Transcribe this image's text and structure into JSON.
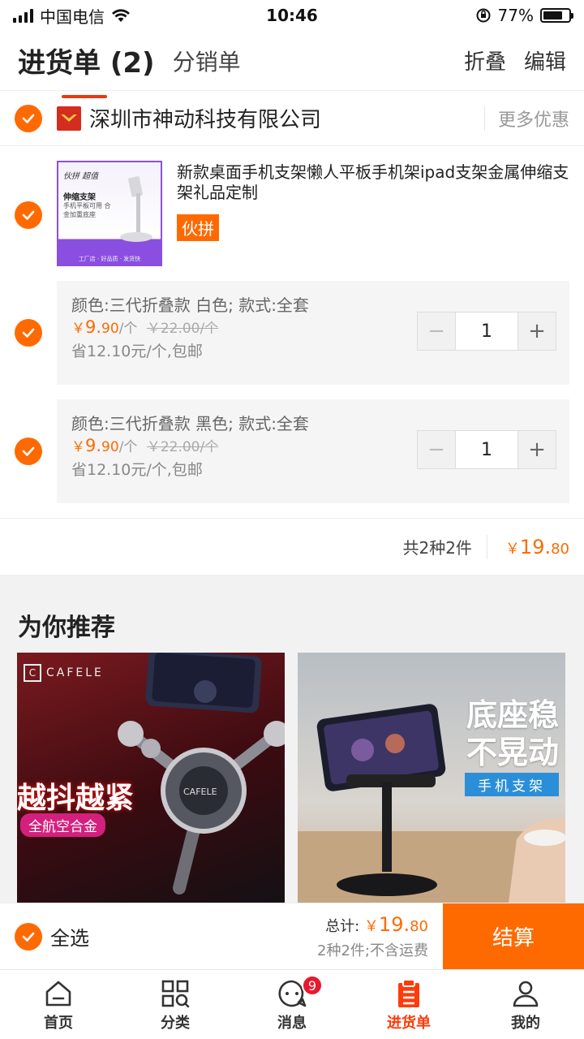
{
  "status_bar": {
    "carrier": "中国电信",
    "time": "10:46",
    "battery": "77%",
    "battery_level": 0.77
  },
  "header": {
    "active_tab": "进货单 (2)",
    "other_tab": "分销单",
    "fold_label": "折叠",
    "edit_label": "编辑"
  },
  "shop": {
    "name": "深圳市神动科技有限公司",
    "more_promo": "更多优惠"
  },
  "product": {
    "title": "新款桌面手机支架懒人平板手机架ipad支架金属伸缩支架礼品定制",
    "tag": "伙拼",
    "image_text": {
      "line1": "伙拼 超值",
      "line2": "伸缩支架",
      "line3": "手机平板可用 合金加重底座",
      "line4": "工厂店 · 好品质 · 发货快"
    }
  },
  "skus": [
    {
      "spec": "颜色:三代折叠款  白色; 款式:全套",
      "price_currency": "￥",
      "price_int": "9.",
      "price_dec": "90",
      "unit": "/个",
      "orig_price": "￥22.00/个",
      "save": "省12.10元/个,包邮",
      "qty": "1",
      "minus": "−",
      "plus": "+"
    },
    {
      "spec": "颜色:三代折叠款  黑色; 款式:全套",
      "price_currency": "￥",
      "price_int": "9.",
      "price_dec": "90",
      "unit": "/个",
      "orig_price": "￥22.00/个",
      "save": "省12.10元/个,包邮",
      "qty": "1",
      "minus": "−",
      "plus": "+"
    }
  ],
  "summary": {
    "count": "共2种2件",
    "currency": "￥",
    "int": "19.",
    "dec": "80"
  },
  "recommend": {
    "title": "为你推荐",
    "card1": {
      "brand": "CAFELE",
      "slogan": "越抖越紧",
      "badge": "全航空合金"
    },
    "card2": {
      "slogan1": "底座稳",
      "slogan2": "不晃动",
      "badge": "手机支架"
    }
  },
  "checkout": {
    "select_all": "全选",
    "total_label": "总计:",
    "currency": "￥",
    "int": "19.",
    "dec": "80",
    "note": "2种2件;不含运费",
    "pay_label": "结算"
  },
  "nav": {
    "items": [
      {
        "label": "首页"
      },
      {
        "label": "分类"
      },
      {
        "label": "消息",
        "badge": "9"
      },
      {
        "label": "进货单"
      },
      {
        "label": "我的"
      }
    ]
  },
  "colors": {
    "accent": "#ff6a00",
    "tab_underline": "#e83a12",
    "badge": "#e8192c"
  }
}
